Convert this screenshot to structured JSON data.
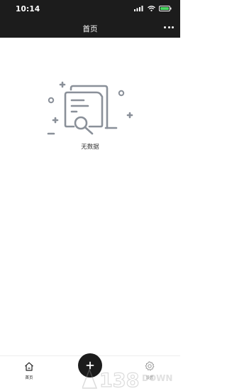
{
  "status_bar": {
    "time": "10:14",
    "icons": [
      "signal-icon",
      "wifi-icon",
      "battery-icon"
    ]
  },
  "nav": {
    "title": "首页",
    "more_icon": "more-icon"
  },
  "empty_state": {
    "message": "无数据",
    "icon": "empty-documents-search-icon"
  },
  "tabbar": {
    "tabs": [
      {
        "label": "首页",
        "icon": "home-icon",
        "active": true
      },
      {
        "label": "设置",
        "icon": "gear-icon",
        "active": false
      }
    ],
    "add_icon": "plus-icon"
  },
  "watermark": {
    "text": "138DOWN"
  },
  "colors": {
    "header_bg": "#1c1c1c",
    "illustration": "#8a9099",
    "battery": "#4cd964",
    "text": "#222222",
    "inactive": "#999999"
  }
}
